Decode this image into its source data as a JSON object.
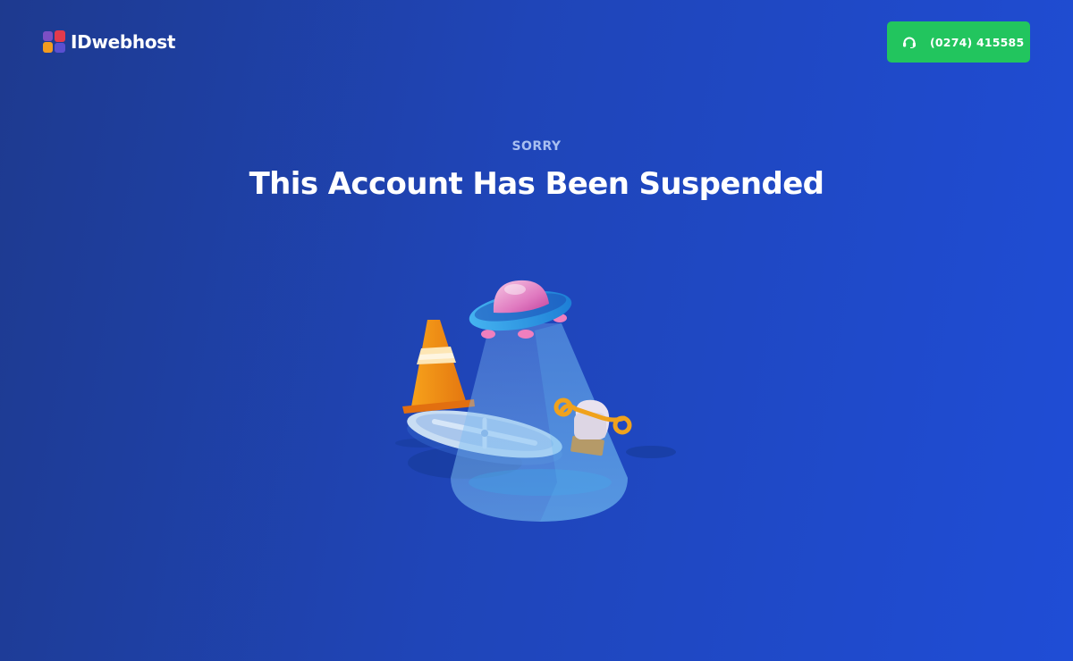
{
  "header": {
    "brand_name": "IDwebhost",
    "phone_label": "(0274) 415585",
    "phone_icon": "headset-icon"
  },
  "main": {
    "eyebrow": "SORRY",
    "title": "This Account Has Been Suspended",
    "illustration_icons": [
      "ufo-icon",
      "traffic-cone-icon",
      "manhole-cover-icon",
      "hand-wrench-icon"
    ]
  },
  "colors": {
    "background_start": "#1e3a8f",
    "background_end": "#1f4dd6",
    "call_button": "#22c55e",
    "eyebrow_text": "#a9bff0"
  }
}
